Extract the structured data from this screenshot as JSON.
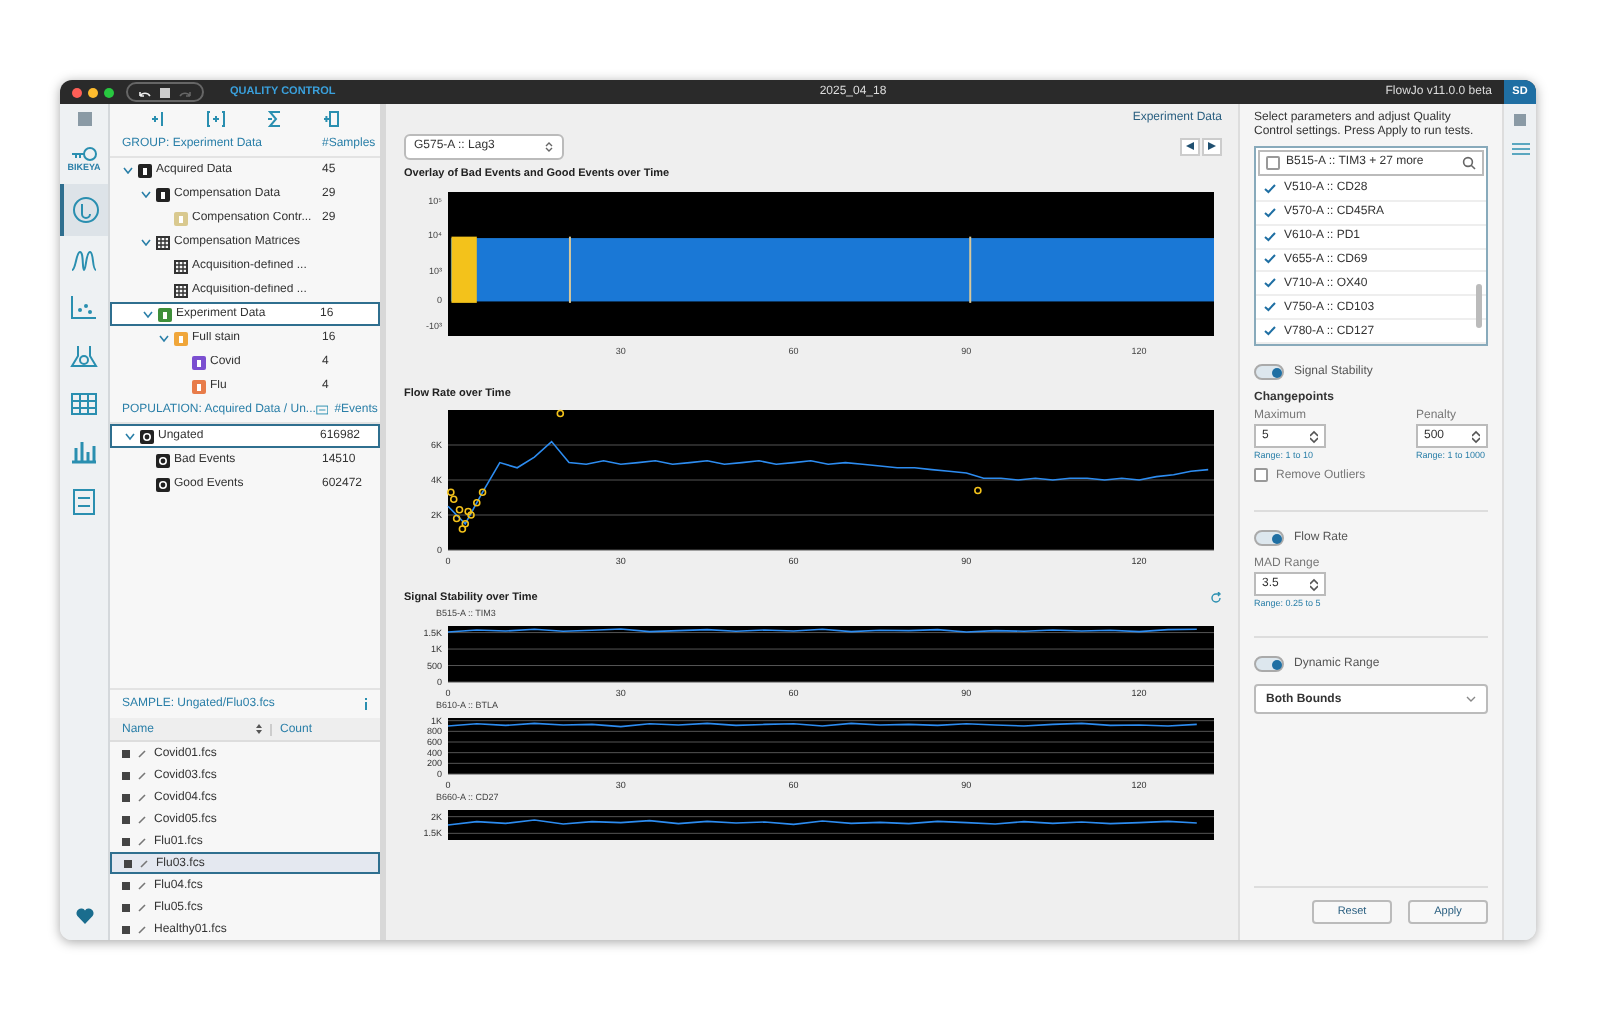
{
  "window": {
    "app_title": "QUALITY CONTROL",
    "title": "2025_04_18",
    "version": "FlowJo v11.0.0 beta",
    "user_initials": "SD"
  },
  "rail": {
    "items": [
      {
        "kind": "key",
        "label": "BIKEYA",
        "selected": false
      },
      {
        "kind": "gauge",
        "selected": true
      },
      {
        "kind": "histogram",
        "selected": false
      },
      {
        "kind": "scatter",
        "selected": false
      },
      {
        "kind": "flask",
        "selected": false
      },
      {
        "kind": "table",
        "selected": false
      },
      {
        "kind": "bars",
        "selected": false
      },
      {
        "kind": "list",
        "selected": false
      }
    ]
  },
  "group_panel": {
    "header": "GROUP: Experiment Data",
    "count_header": "#Samples",
    "tree": [
      {
        "label": "Acquired Data",
        "count": "45",
        "kind": "group",
        "color": "#222222",
        "expanded": true,
        "selected": false,
        "children": [
          {
            "label": "Compensation Data",
            "count": "29",
            "kind": "group",
            "color": "#222222",
            "expanded": true,
            "selected": false,
            "children": [
              {
                "label": "Compensation Contr...",
                "count": "29",
                "kind": "group",
                "color": "#d9c98f",
                "selected": false
              }
            ]
          },
          {
            "label": "Compensation Matrices",
            "kind": "matrix",
            "color": "#333333",
            "expanded": true,
            "selected": false,
            "children": [
              {
                "label": "Acquisition-defined ...",
                "kind": "matrix",
                "color": "#333333",
                "selected": false
              },
              {
                "label": "Acquisition-defined ...",
                "kind": "matrix",
                "color": "#333333",
                "selected": false
              }
            ]
          },
          {
            "label": "Experiment Data",
            "count": "16",
            "kind": "group",
            "color": "#3f8f3a",
            "expanded": true,
            "selected": true,
            "children": [
              {
                "label": "Full stain",
                "count": "16",
                "kind": "group",
                "color": "#f0a63a",
                "expanded": true,
                "selected": false,
                "children": [
                  {
                    "label": "Covid",
                    "count": "4",
                    "kind": "group",
                    "color": "#7b4fd0",
                    "selected": false
                  },
                  {
                    "label": "Flu",
                    "count": "4",
                    "kind": "group",
                    "color": "#e87c4a",
                    "selected": false
                  }
                ]
              }
            ]
          }
        ]
      }
    ]
  },
  "population_panel": {
    "header": "POPULATION: Acquired Data / Un...",
    "count_header": "#Events",
    "tree": [
      {
        "label": "Ungated",
        "count": "616982",
        "kind": "gate",
        "color": "#222222",
        "expanded": true,
        "selected": true,
        "children": [
          {
            "label": "Bad Events",
            "count": "14510",
            "kind": "gate",
            "color": "#222222",
            "selected": false
          },
          {
            "label": "Good Events",
            "count": "602472",
            "kind": "gate",
            "color": "#222222",
            "selected": false
          }
        ]
      }
    ]
  },
  "sample_panel": {
    "header": "SAMPLE: Ungated/Flu03.fcs",
    "columns": [
      "Name",
      "Count"
    ],
    "rows": [
      {
        "name": "Covid01.fcs",
        "selected": false
      },
      {
        "name": "Covid03.fcs",
        "selected": false
      },
      {
        "name": "Covid04.fcs",
        "selected": false
      },
      {
        "name": "Covid05.fcs",
        "selected": false
      },
      {
        "name": "Flu01.fcs",
        "selected": false
      },
      {
        "name": "Flu03.fcs",
        "selected": true
      },
      {
        "name": "Flu04.fcs",
        "selected": false
      },
      {
        "name": "Flu05.fcs",
        "selected": false
      },
      {
        "name": "Healthy01.fcs",
        "selected": false
      }
    ]
  },
  "main": {
    "breadcrumb": "Experiment Data",
    "parameter_select": "G575-A :: Lag3",
    "overlay": {
      "title": "Overlay of Bad Events and Good Events over Time",
      "y_ticks": [
        "10⁵",
        "10⁴",
        "10³",
        "0",
        "-10³"
      ],
      "x_ticks": [
        "30",
        "60",
        "90",
        "120"
      ]
    },
    "flow_rate": {
      "title": "Flow Rate over Time",
      "chart_data": {
        "type": "line",
        "x": [
          0,
          3,
          6,
          9,
          12,
          15,
          18,
          21,
          24,
          27,
          30,
          33,
          36,
          39,
          42,
          45,
          48,
          51,
          54,
          57,
          60,
          63,
          66,
          69,
          72,
          75,
          78,
          81,
          84,
          87,
          90,
          93,
          96,
          99,
          102,
          105,
          108,
          111,
          114,
          117,
          120,
          123,
          126,
          129,
          132
        ],
        "grid": true,
        "series": [
          {
            "color": "#2d8cf0",
            "values": [
              2500,
              1500,
              3300,
              5000,
              4700,
              5300,
              6200,
              5000,
              4900,
              5100,
              4900,
              5000,
              5100,
              4900,
              5000,
              5100,
              4900,
              5000,
              5100,
              4900,
              5000,
              5100,
              4900,
              5000,
              4900,
              4800,
              4700,
              4700,
              4600,
              4500,
              4400,
              4100,
              4100,
              4000,
              4100,
              4000,
              4100,
              4100,
              4000,
              4100,
              4000,
              4200,
              4300,
              4500,
              4600
            ]
          }
        ],
        "xlim": [
          0,
          133
        ],
        "ylim": [
          0,
          8000
        ],
        "xticks": [
          0,
          30,
          60,
          90,
          120
        ],
        "yticks": [
          {
            "value": 6000,
            "label": "6K"
          },
          {
            "value": 4000,
            "label": "4K"
          },
          {
            "value": 2000,
            "label": "2K"
          },
          {
            "value": 0,
            "label": "0"
          }
        ]
      }
    },
    "signal_stability": {
      "title": "Signal Stability over Time",
      "channels": [
        {
          "label": "B515-A :: TIM3",
          "chart_data": {
            "type": "line",
            "x": [
              0,
              5,
              10,
              15,
              20,
              25,
              30,
              35,
              40,
              45,
              50,
              55,
              60,
              65,
              70,
              75,
              80,
              85,
              90,
              95,
              100,
              105,
              110,
              115,
              120,
              125,
              130
            ],
            "grid": true,
            "series": [
              {
                "color": "#2d8cf0",
                "values": [
                  1520,
                  1580,
                  1550,
                  1600,
                  1540,
                  1570,
                  1610,
                  1530,
                  1560,
                  1590,
                  1540,
                  1580,
                  1550,
                  1600,
                  1530,
                  1570,
                  1560,
                  1590,
                  1520,
                  1560,
                  1540,
                  1580,
                  1550,
                  1570,
                  1530,
                  1590,
                  1600
                ]
              }
            ],
            "xlim": [
              0,
              133
            ],
            "ylim": [
              0,
              1700
            ],
            "xticks": [
              0,
              30,
              60,
              90,
              120
            ],
            "yticks": [
              {
                "value": 1500,
                "label": "1.5K"
              },
              {
                "value": 1000,
                "label": "1K"
              },
              {
                "value": 500,
                "label": "500"
              },
              {
                "value": 0,
                "label": "0"
              }
            ]
          }
        },
        {
          "label": "B610-A :: BTLA",
          "chart_data": {
            "type": "line",
            "x": [
              0,
              5,
              10,
              15,
              20,
              25,
              30,
              35,
              40,
              45,
              50,
              55,
              60,
              65,
              70,
              75,
              80,
              85,
              90,
              95,
              100,
              105,
              110,
              115,
              120,
              125,
              130
            ],
            "grid": true,
            "series": [
              {
                "color": "#2d8cf0",
                "values": [
                  900,
                  940,
                  910,
                  950,
                  920,
                  930,
                  890,
                  940,
                  920,
                  950,
                  910,
                  930,
                  940,
                  900,
                  950,
                  920,
                  930,
                  910,
                  940,
                  920,
                  900,
                  930,
                  950,
                  910,
                  920,
                  900,
                  930
                ]
              }
            ],
            "xlim": [
              0,
              133
            ],
            "ylim": [
              0,
              1050
            ],
            "xticks": [
              0,
              30,
              60,
              90,
              120
            ],
            "yticks": [
              {
                "value": 1000,
                "label": "1K"
              },
              {
                "value": 800,
                "label": "800"
              },
              {
                "value": 600,
                "label": "600"
              },
              {
                "value": 400,
                "label": "400"
              },
              {
                "value": 200,
                "label": "200"
              },
              {
                "value": 0,
                "label": "0"
              }
            ]
          }
        },
        {
          "label": "B660-A :: CD27",
          "chart_data": {
            "type": "line",
            "x": [
              0,
              5,
              10,
              15,
              20,
              25,
              30,
              35,
              40,
              45,
              50,
              55,
              60,
              65,
              70,
              75,
              80,
              85,
              90,
              95,
              100,
              105,
              110,
              115,
              120,
              125,
              130
            ],
            "grid": true,
            "series": [
              {
                "color": "#2d8cf0",
                "values": [
                  1750,
                  1850,
                  1800,
                  1900,
                  1780,
                  1850,
                  1820,
                  1880,
                  1790,
                  1860,
                  1810,
                  1840,
                  1770,
                  1870,
                  1800,
                  1830,
                  1790,
                  1860,
                  1820,
                  1780,
                  1850,
                  1800,
                  1840,
                  1790,
                  1820,
                  1860,
                  1810
                ]
              }
            ],
            "xlim": [
              0,
              133
            ],
            "ylim": [
              1300,
              2200
            ],
            "yticks": [
              {
                "value": 2000,
                "label": "2K"
              },
              {
                "value": 1500,
                "label": "1.5K"
              }
            ]
          }
        }
      ]
    }
  },
  "qc_panel": {
    "instructions": "Select parameters and adjust Quality Control settings. Press Apply to run tests.",
    "parameter_search": {
      "value": "B515-A :: TIM3 + 27 more",
      "checked": false
    },
    "parameters": [
      {
        "label": "V510-A :: CD28",
        "checked": true
      },
      {
        "label": "V570-A :: CD45RA",
        "checked": true
      },
      {
        "label": "V610-A :: PD1",
        "checked": true
      },
      {
        "label": "V655-A :: CD69",
        "checked": true
      },
      {
        "label": "V710-A :: OX40",
        "checked": true
      },
      {
        "label": "V750-A :: CD103",
        "checked": true
      },
      {
        "label": "V780-A :: CD127",
        "checked": true
      }
    ],
    "signal_stability": {
      "label": "Signal Stability",
      "on": true,
      "heading": "Changepoints",
      "fields": [
        {
          "label": "Maximum",
          "value": "5",
          "hint": "Range: 1 to 10"
        },
        {
          "label": "Penalty",
          "value": "500",
          "hint": "Range: 1 to 1000"
        }
      ],
      "remove_outliers": {
        "label": "Remove Outliers",
        "checked": false
      }
    },
    "flow_rate": {
      "label": "Flow Rate",
      "on": true,
      "fields": [
        {
          "label": "MAD Range",
          "value": "3.5",
          "hint": "Range: 0.25 to 5"
        }
      ]
    },
    "dynamic_range": {
      "label": "Dynamic Range",
      "on": true,
      "select": "Both Bounds"
    },
    "buttons": [
      "Reset",
      "Apply"
    ]
  }
}
